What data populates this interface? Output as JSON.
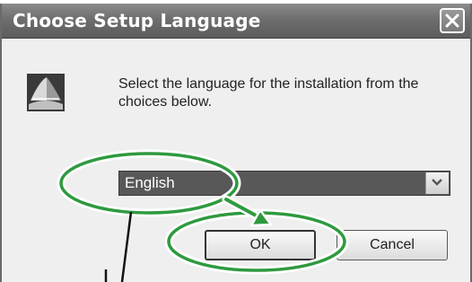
{
  "dialog": {
    "title": "Choose Setup Language",
    "message": "Select the language for the installation from the choices below.",
    "language_select": {
      "selected": "English"
    },
    "ok_label": "OK",
    "cancel_label": "Cancel"
  },
  "icons": {
    "close": "close-icon",
    "app": "installer-app-icon",
    "dropdown": "chevron-down-icon"
  },
  "colors": {
    "titlebar": "#6e6e6e",
    "dialog_bg": "#efefef",
    "annotation_green": "#2e9a3e"
  }
}
